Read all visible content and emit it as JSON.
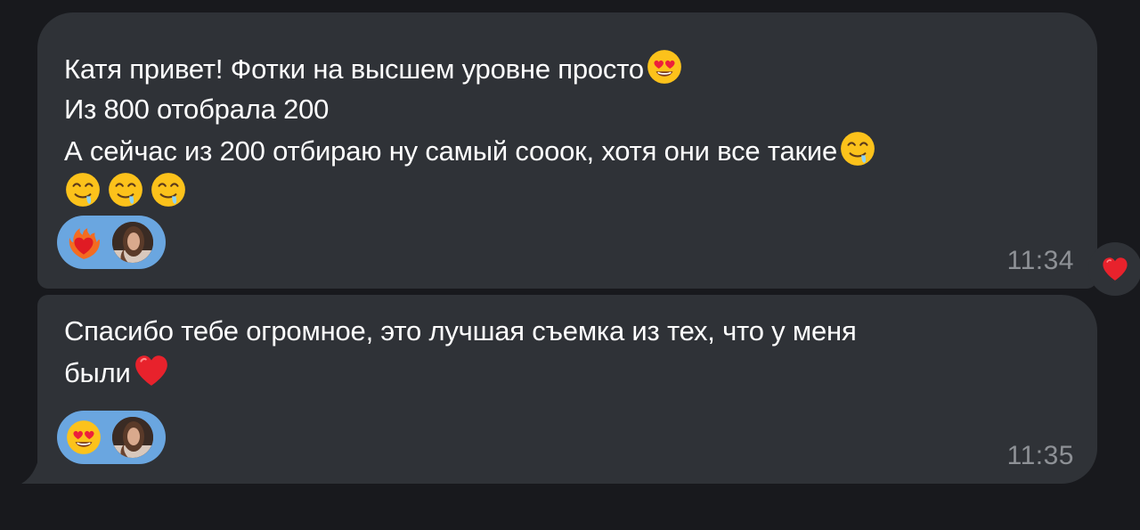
{
  "messages": [
    {
      "lines": [
        "Катя привет! Фотки на высшем уровне просто",
        "Из 800 отобрала 200",
        "А сейчас из 200 отбираю ну самый сооок, хотя они все такие"
      ],
      "emojis": [
        "heart-eyes",
        "drooling",
        "drooling",
        "drooling",
        "drooling"
      ],
      "reaction": "heart-on-fire",
      "time": "11:34"
    },
    {
      "lines": [
        "Спасибо тебе огромное, это лучшая съемка из тех, что у меня",
        "были"
      ],
      "emojis": [
        "red-heart"
      ],
      "reaction": "heart-eyes",
      "time": "11:35"
    }
  ],
  "quick_reaction": "red-heart",
  "colors": {
    "background": "#18191d",
    "bubble": "#2f3237",
    "reaction_pill": "#6aa6e0",
    "time": "#8e9196"
  }
}
